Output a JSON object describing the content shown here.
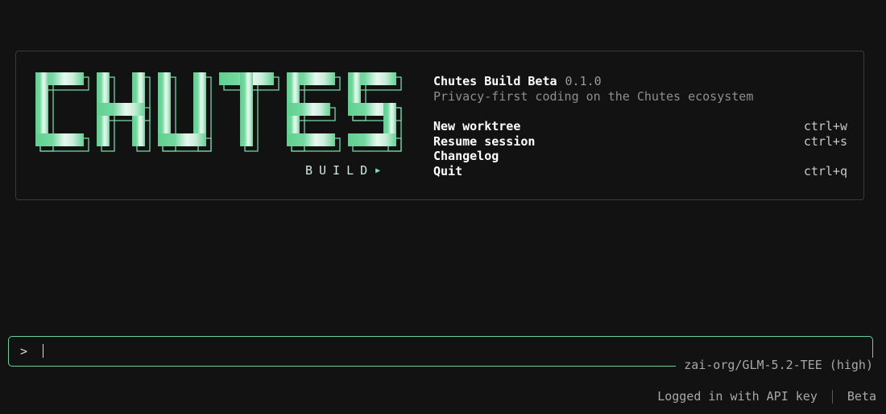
{
  "logo": {
    "word": "CHUTES",
    "sub": "BUILD"
  },
  "info": {
    "app_title": "Chutes Build Beta",
    "version": "0.1.0",
    "tagline": "Privacy-first coding on the Chutes ecosystem"
  },
  "menu": {
    "items": [
      {
        "label": "New worktree",
        "shortcut": "ctrl+w"
      },
      {
        "label": "Resume session",
        "shortcut": "ctrl+s"
      },
      {
        "label": "Changelog",
        "shortcut": ""
      },
      {
        "label": "Quit",
        "shortcut": "ctrl+q"
      }
    ]
  },
  "prompt": {
    "symbol": ">",
    "value": "",
    "placeholder": ""
  },
  "model": {
    "label": "zai-org/GLM-5.2-TEE (high)"
  },
  "status": {
    "login": "Logged in with API key",
    "channel": "Beta"
  },
  "colors": {
    "background": "#121212",
    "accent": "#6fcf9b",
    "logo_light": "#e6f6ee",
    "panel_border": "#3a3a3a"
  },
  "icons": {
    "logo_arrow": "play-triangle-icon"
  }
}
